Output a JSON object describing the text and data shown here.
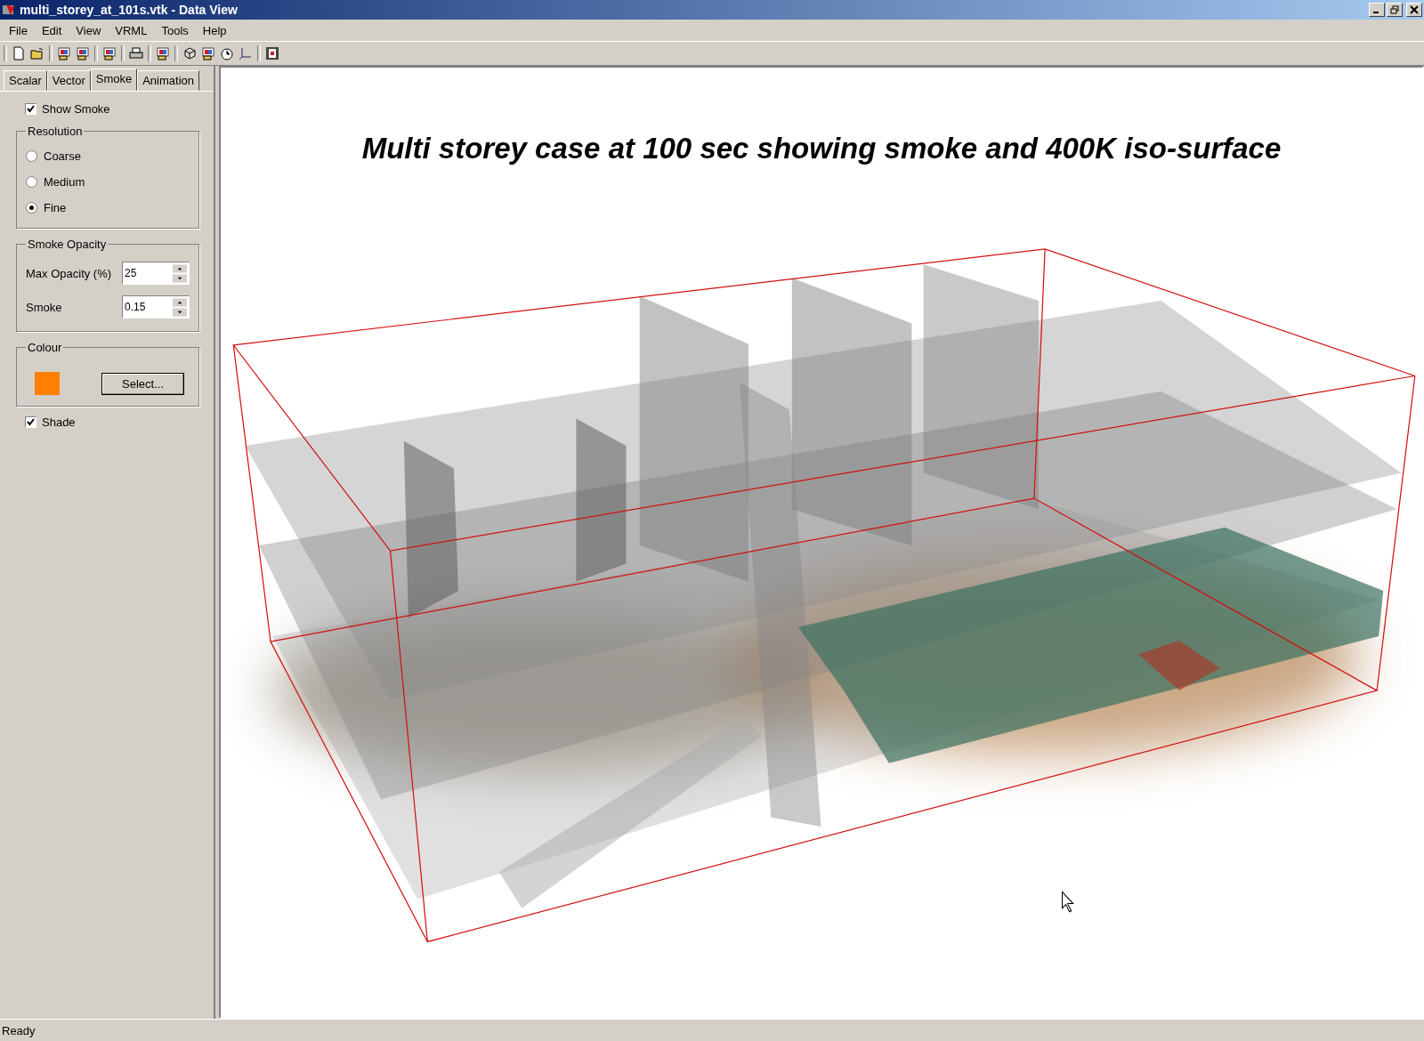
{
  "window": {
    "title": "multi_storey_at_101s.vtk - Data View"
  },
  "menu": [
    "File",
    "Edit",
    "View",
    "VRML",
    "Tools",
    "Help"
  ],
  "tabs": [
    {
      "label": "Scalar",
      "selected": false
    },
    {
      "label": "Vector",
      "selected": false
    },
    {
      "label": "Smoke",
      "selected": true
    },
    {
      "label": "Animation",
      "selected": false
    }
  ],
  "show_smoke": {
    "label": "Show Smoke",
    "checked": true
  },
  "resolution": {
    "title": "Resolution",
    "options": [
      {
        "label": "Coarse",
        "selected": false
      },
      {
        "label": "Medium",
        "selected": false
      },
      {
        "label": "Fine",
        "selected": true
      }
    ]
  },
  "smoke_opacity": {
    "title": "Smoke Opacity",
    "fields": [
      {
        "label": "Max Opacity (%)",
        "value": "25"
      },
      {
        "label": "Smoke",
        "value": "0.15"
      }
    ]
  },
  "colour": {
    "title": "Colour",
    "color": "#ff8000",
    "button": "Select..."
  },
  "shade": {
    "label": "Shade",
    "checked": true
  },
  "viewport": {
    "title": "Multi storey case at 100 sec showing smoke and 400K iso-surface"
  },
  "status_bar": "Ready"
}
